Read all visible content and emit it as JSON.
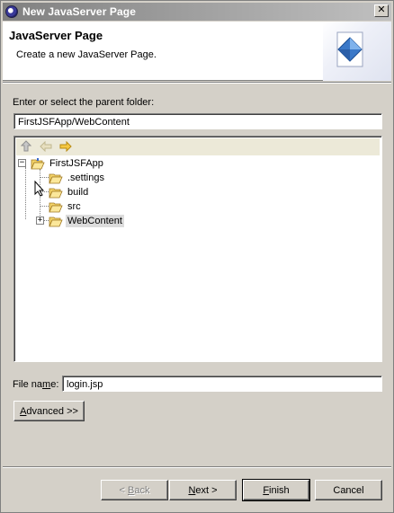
{
  "window": {
    "title": "New JavaServer Page"
  },
  "banner": {
    "title": "JavaServer Page",
    "description": "Create a new JavaServer Page."
  },
  "parent_folder": {
    "label": "Enter or select the parent folder:",
    "value": "FirstJSFApp/WebContent"
  },
  "tree": {
    "toolbar": [
      "up-folder-icon",
      "back-arrow-icon",
      "forward-arrow-icon"
    ],
    "root": {
      "label": "FirstJSFApp",
      "expanded": true
    },
    "children": [
      {
        "label": ".settings",
        "expander": false
      },
      {
        "label": "build",
        "expander": true
      },
      {
        "label": "src",
        "expander": false
      },
      {
        "label": "WebContent",
        "expander": true,
        "selected": true
      }
    ]
  },
  "file_name": {
    "label_pre": "File na",
    "label_mnemonic": "m",
    "label_post": "e:",
    "value": "login.jsp"
  },
  "advanced": {
    "label_mnemonic": "A",
    "label_rest": "dvanced >>"
  },
  "buttons": {
    "back": {
      "pre": "< ",
      "mnemonic": "B",
      "post": "ack",
      "enabled": false
    },
    "next": {
      "mnemonic": "N",
      "post": "ext >",
      "enabled": true
    },
    "finish": {
      "mnemonic": "F",
      "post": "inish",
      "enabled": true,
      "default": true
    },
    "cancel": {
      "label": "Cancel",
      "enabled": true
    }
  },
  "colors": {
    "titlebar_start": "#808080",
    "titlebar_end": "#c0c0c0",
    "dialog_bg": "#d4d0c8",
    "selection_bg": "#dcdcdc",
    "folder_yellow": "#f5d56a"
  }
}
